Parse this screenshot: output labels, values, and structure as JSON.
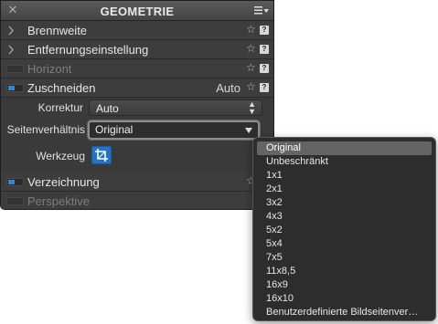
{
  "panel": {
    "title": "GEOMETRIE",
    "rows": [
      {
        "label": "Brennweite"
      },
      {
        "label": "Entfernungseinstellung"
      },
      {
        "label": "Horizont"
      },
      {
        "label": "Zuschneiden",
        "value": "Auto"
      },
      {
        "label": "Verzeichnung"
      },
      {
        "label": "Perspektive"
      }
    ],
    "korrektur": {
      "label": "Korrektur",
      "value": "Auto"
    },
    "seitenverhaeltnis": {
      "label": "Seitenverhältnis",
      "value": "Original"
    },
    "werkzeug": {
      "label": "Werkzeug"
    },
    "help_glyph": "?"
  },
  "dropdown": {
    "options": [
      "Original",
      "Unbeschränkt",
      "1x1",
      "2x1",
      "3x2",
      "4x3",
      "5x2",
      "5x4",
      "7x5",
      "11x8,5",
      "16x9",
      "16x10",
      "Benutzerdefinierte Bildseitenver…"
    ],
    "selected_index": 0
  },
  "colors": {
    "accent": "#2f86d6",
    "panel_bg": "#3a3a3a",
    "dropdown_bg": "#2d2d2d",
    "selection_bg": "#646464"
  },
  "icons": {
    "close": "close-icon",
    "menu": "panel-menu-icon",
    "expand": "chevron-right-icon",
    "favorite": "star-outline-icon",
    "help": "help-icon",
    "crop": "crop-icon"
  }
}
